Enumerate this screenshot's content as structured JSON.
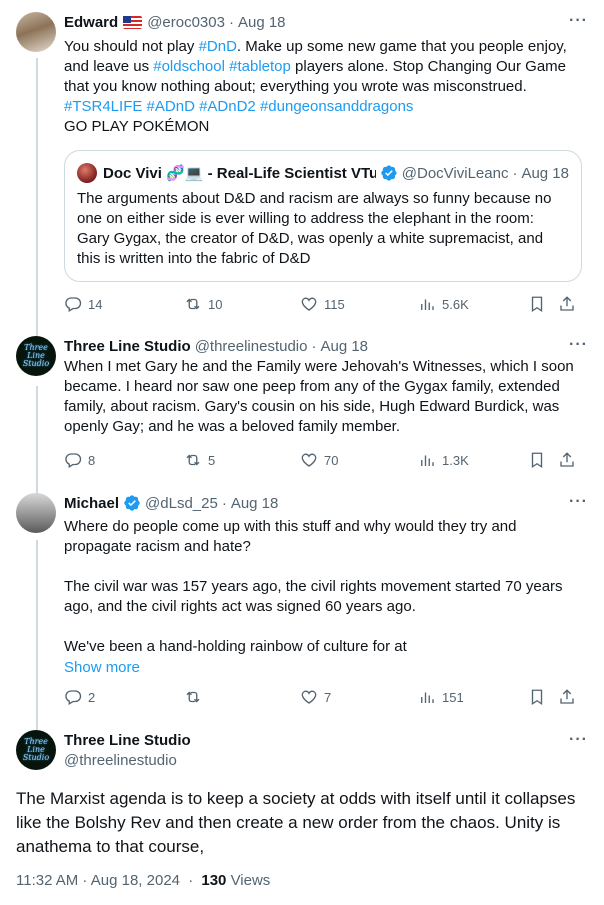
{
  "tweets": [
    {
      "name": "Edward",
      "handle": "@eroc0303",
      "date": "Aug 18",
      "lines": [
        [
          "You should not play ",
          {
            "tag": "#DnD"
          },
          ". Make up some new game that you people enjoy,"
        ],
        [
          "and leave us ",
          {
            "tag": "#oldschool"
          },
          " ",
          {
            "tag": "#tabletop"
          },
          " players alone. Stop Changing Our Game"
        ],
        [
          "that you know nothing about; everything you wrote was misconstrued."
        ],
        [
          {
            "tag": "#TSR4LIFE"
          },
          " ",
          {
            "tag": "#ADnD"
          },
          " ",
          {
            "tag": "#ADnD2"
          },
          " ",
          {
            "tag": "#dungeonsanddragons"
          }
        ],
        [
          "GO PLAY POKÉMON"
        ]
      ],
      "quote": {
        "name": "Doc Vivi 🧬💻 - Real-Life Scientist VTu",
        "handle": "@DocViviLeanc",
        "date": "Aug 18",
        "text": "The arguments about D&D and racism are always so funny because no one on either side is ever willing to address the elephant in the room: Gary Gygax, the creator of D&D, was openly a white supremacist, and this is written into the fabric of D&D"
      },
      "replies": "14",
      "reposts": "10",
      "likes": "115",
      "views": "5.6K"
    },
    {
      "name": "Three Line Studio",
      "handle": "@threelinestudio",
      "date": "Aug 18",
      "text": "When I met Gary he and the Family were Jehovah's Witnesses, which I soon became.  I heard nor saw one peep from any of the Gygax family, extended family, about racism.  Gary's cousin on his side, Hugh Edward Burdick, was openly Gay; and he was a beloved family member.",
      "replies": "8",
      "reposts": "5",
      "likes": "70",
      "views": "1.3K"
    },
    {
      "name": "Michael",
      "handle": "@dLsd_25",
      "date": "Aug 18",
      "paragraphs": [
        "Where do people come up with this stuff and why would they try and propagate racism and hate?",
        "The civil war was 157 years ago, the civil rights movement started 70 years ago, and the civil rights act was signed 60 years ago.",
        "We've been a hand-holding rainbow of culture for at"
      ],
      "show_more": "Show more",
      "replies": "2",
      "reposts": "",
      "likes": "7",
      "views": "151"
    }
  ],
  "main": {
    "name": "Three Line Studio",
    "handle": "@threelinestudio",
    "text": "The Marxist agenda is to keep a society at odds with itself until it collapses like the Bolshy Rev and then create a new order from the chaos.  Unity is anathema to that course,",
    "time": "11:32 AM · Aug 18, 2024",
    "views_count": "130",
    "views_label": "Views",
    "avatar_text": "Three Line Studio"
  },
  "colors": {
    "accent": "#1d9bf0",
    "muted": "#536471",
    "text": "#0f1419",
    "border": "#cfd9de"
  }
}
